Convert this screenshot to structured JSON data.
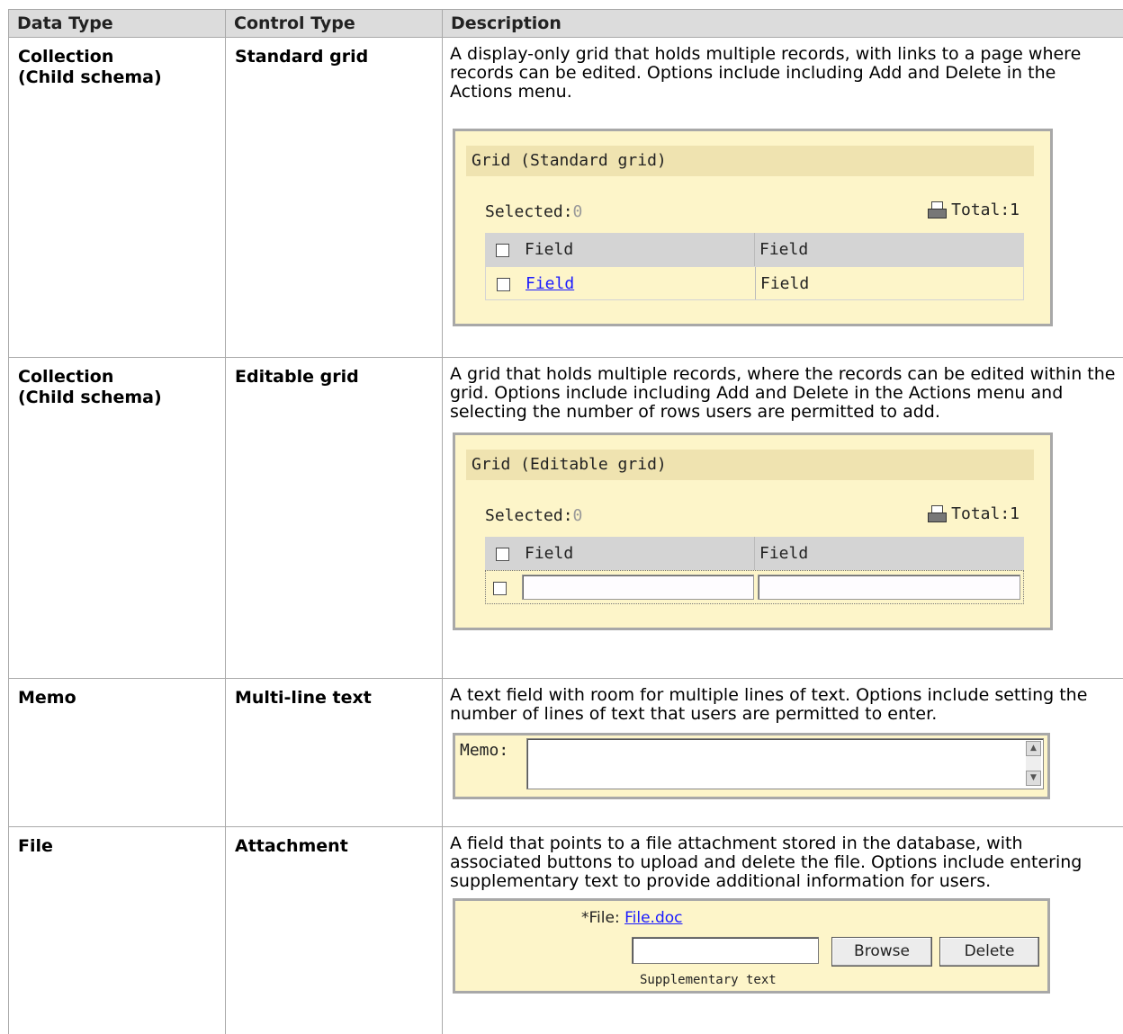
{
  "headers": [
    "Data Type",
    "Control Type",
    "Description"
  ],
  "rows": [
    {
      "data_type": "Collection\n(Child schema)",
      "control_type": "Standard grid",
      "description": "A display-only grid that holds multiple records, with links to a page where records can be edited. Options include including Add and Delete in the Actions menu.",
      "panel": {
        "title": "Grid (Standard grid)",
        "selected_label": "Selected:",
        "selected_count": "0",
        "total_label": "Total:1",
        "col1": "Field",
        "col2": "Field",
        "row_link": "Field",
        "row_value": "Field"
      }
    },
    {
      "data_type": "Collection\n(Child schema)",
      "control_type": "Editable grid",
      "description": "A grid that holds multiple records, where the records can be edited within the grid. Options include including Add and Delete in the Actions menu and selecting the number of rows users are permitted to add.",
      "panel": {
        "title": "Grid (Editable grid)",
        "selected_label": "Selected:",
        "selected_count": "0",
        "total_label": "Total:1",
        "col1": "Field",
        "col2": "Field"
      }
    },
    {
      "data_type": "Memo",
      "control_type": "Multi-line text",
      "description": "A text field with room for multiple lines of text. Options include setting the number of lines of text that users are permitted to enter.",
      "panel": {
        "label": "Memo:"
      }
    },
    {
      "data_type": "File",
      "control_type": "Attachment",
      "description": "A field that points to a file attachment stored in the database, with associated buttons to upload and delete the file. Options include entering supplementary text to provide additional information for users.",
      "panel": {
        "label": "*File:",
        "file_link": "File.doc",
        "browse": "Browse",
        "delete": "Delete",
        "supplementary": "Supplementary text"
      }
    }
  ]
}
